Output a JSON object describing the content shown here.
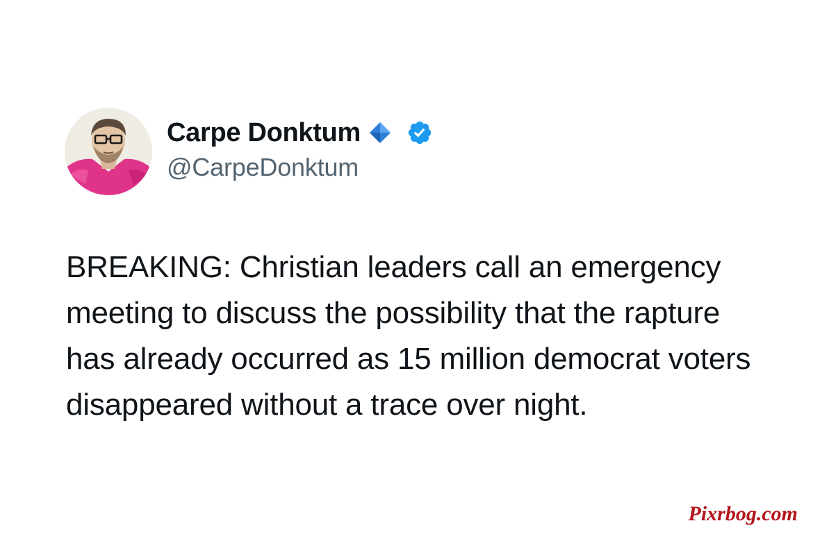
{
  "tweet": {
    "author": {
      "display_name": "Carpe Donktum",
      "handle": "@CarpeDonktum",
      "avatar_icon": "avatar-man-with-glasses-pink-shirt",
      "badges": [
        "blue-diamond-icon",
        "verified-badge-icon"
      ]
    },
    "text": "BREAKING: Christian leaders call an emergency meeting to discuss the possibility that the rapture has already occurred as 15 million democrat voters disappeared without a trace over night."
  },
  "watermark": {
    "text": "Pixrbog.com",
    "color": "#b3141b"
  },
  "colors": {
    "text_primary": "#0f1419",
    "text_secondary": "#536471",
    "verified_blue": "#1d9bf0",
    "diamond_blue": "#2b7fd8"
  }
}
